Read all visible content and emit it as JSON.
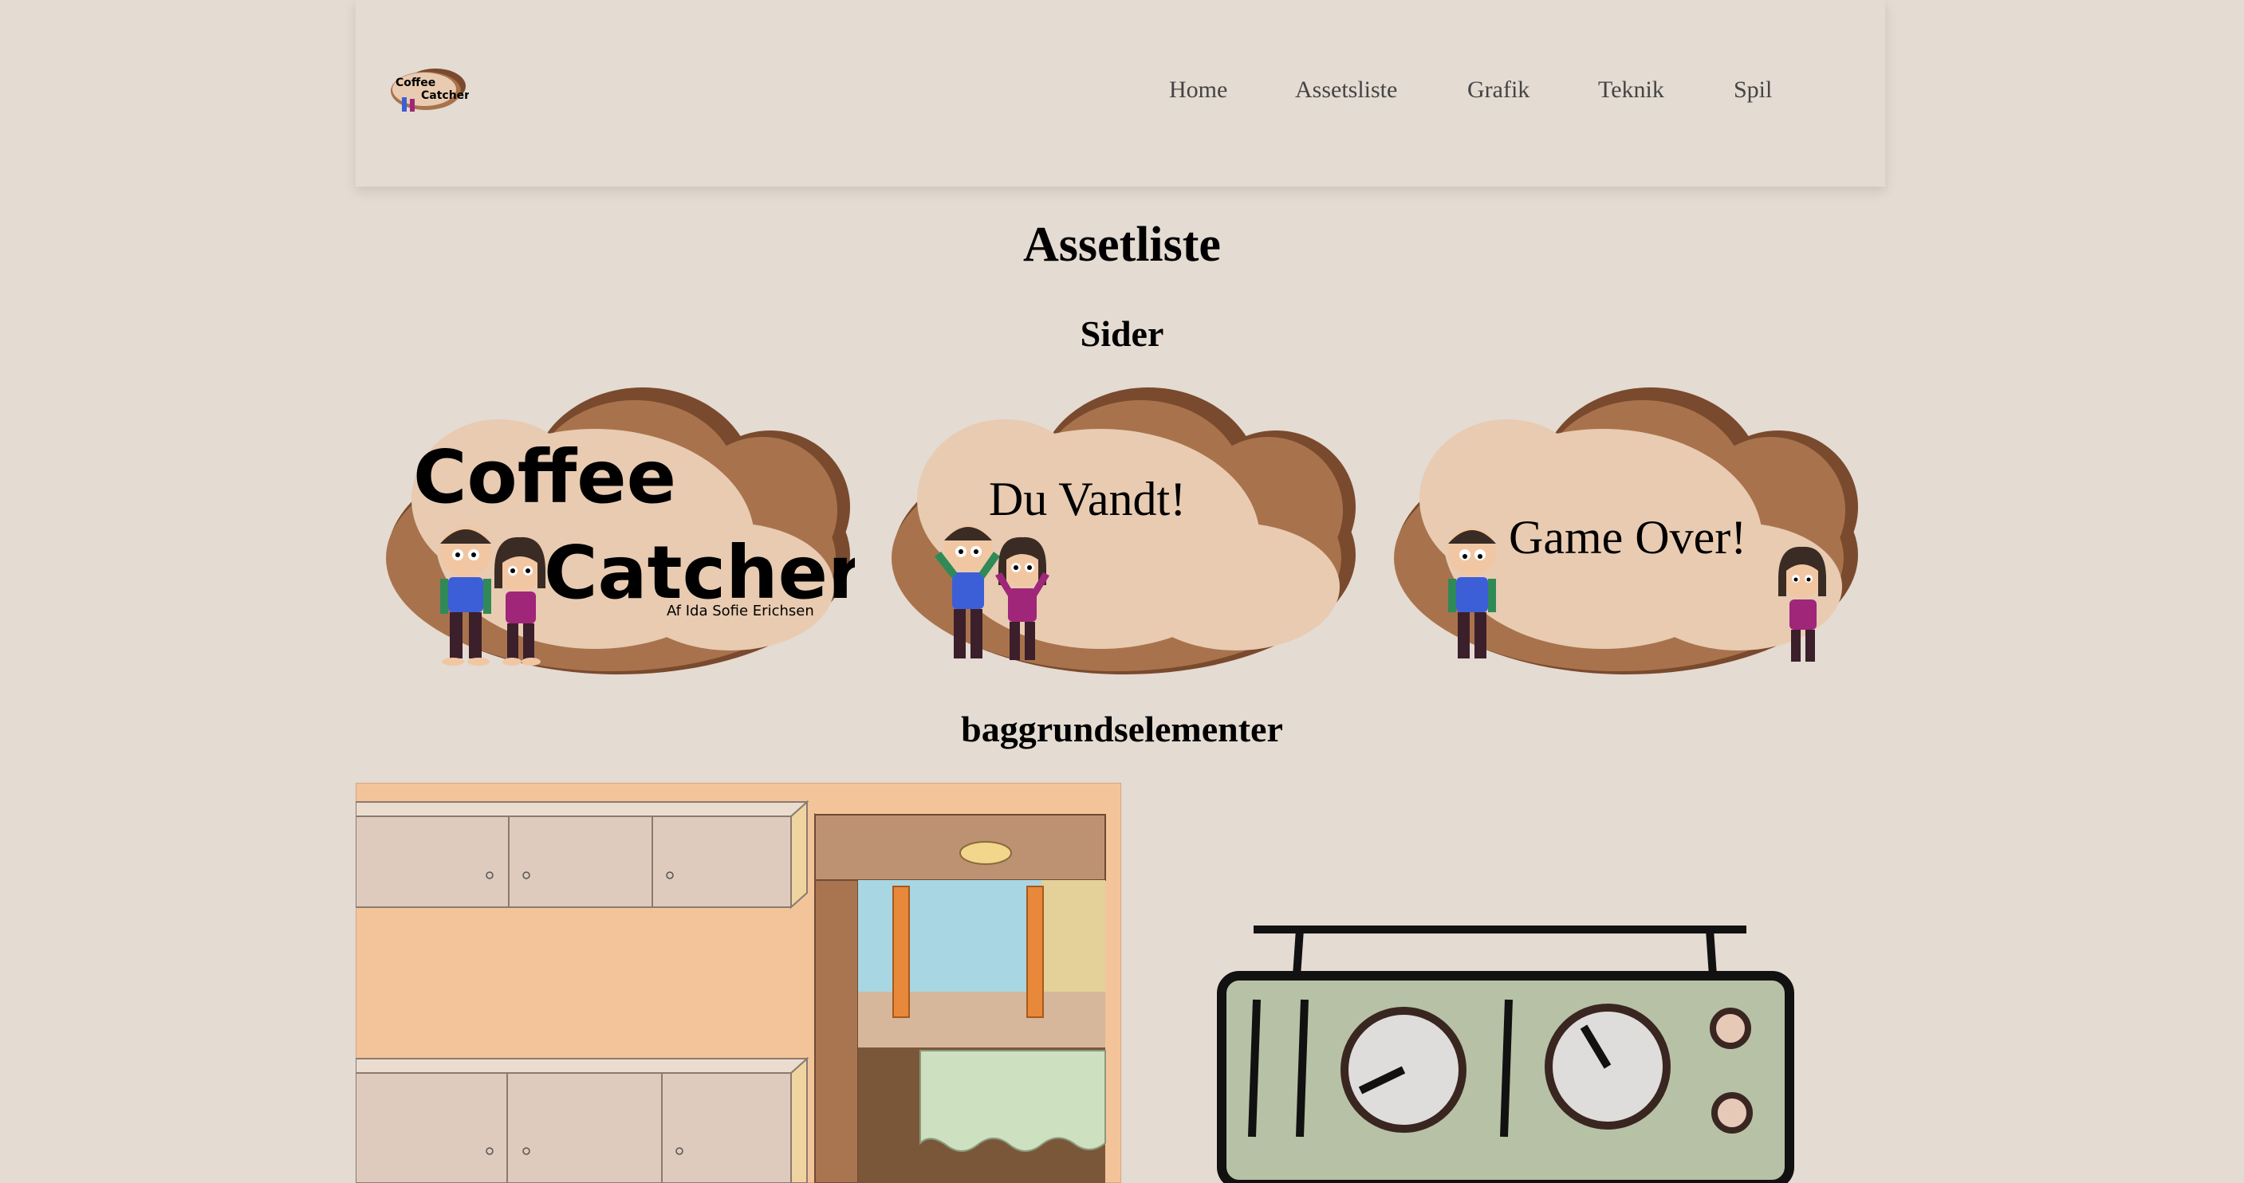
{
  "nav": {
    "logo_alt": "Coffee Catcher",
    "items": [
      {
        "label": "Home"
      },
      {
        "label": "Assetsliste"
      },
      {
        "label": "Grafik"
      },
      {
        "label": "Teknik"
      },
      {
        "label": "Spil"
      }
    ]
  },
  "page": {
    "title": "Assetliste",
    "section_pages": "Sider",
    "section_background": "baggrundselementer"
  },
  "pages": {
    "start": {
      "line1": "Coffee",
      "line2": "Catcher",
      "byline": "Af Ida Sofie Erichsen"
    },
    "win": {
      "text": "Du Vandt!"
    },
    "lose": {
      "text": "Game Over!"
    }
  },
  "logo_text": {
    "line1": "Coffee",
    "line2": "Catcher"
  },
  "colors": {
    "background": "#e4dbd2",
    "cloud_light": "#e8cbb1",
    "cloud_mid": "#a8734c",
    "cloud_dark": "#7a4a2e",
    "kitchen_wall": "#f3c49a",
    "radio_body": "#b7c1a6"
  }
}
